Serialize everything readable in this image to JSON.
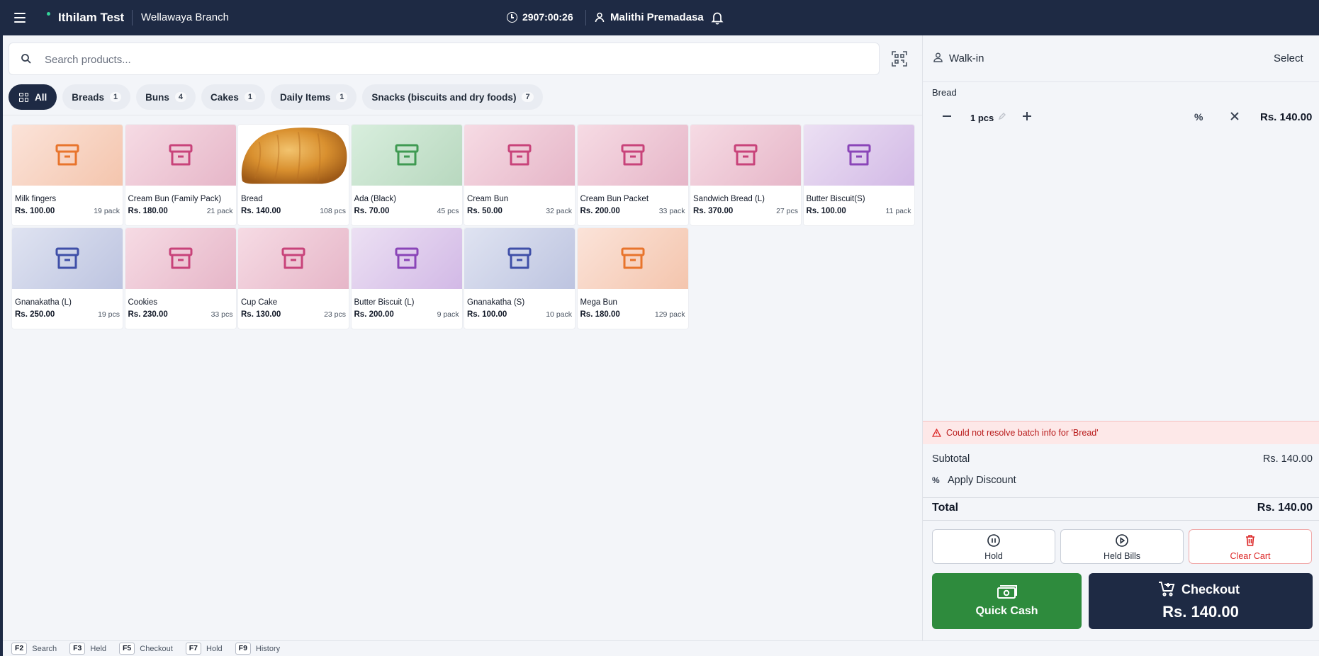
{
  "header": {
    "company": "Ithilam Test",
    "branch": "Wellawaya Branch",
    "session_time": "2907:00:26",
    "user": "Malithi Premadasa"
  },
  "search": {
    "placeholder": "Search products..."
  },
  "categories": [
    {
      "label": "All",
      "count": ""
    },
    {
      "label": "Breads",
      "count": "1"
    },
    {
      "label": "Buns",
      "count": "4"
    },
    {
      "label": "Cakes",
      "count": "1"
    },
    {
      "label": "Daily Items",
      "count": "1"
    },
    {
      "label": "Snacks (biscuits and dry foods)",
      "count": "7"
    }
  ],
  "products": [
    {
      "name": "Milk fingers",
      "price": "Rs. 100.00",
      "stock": "19 pack",
      "color": "orange"
    },
    {
      "name": "Cream Bun (Family Pack)",
      "price": "Rs. 180.00",
      "stock": "21 pack",
      "color": "pink"
    },
    {
      "name": "Bread",
      "price": "Rs. 140.00",
      "stock": "108 pcs",
      "color": "bread"
    },
    {
      "name": "Ada (Black)",
      "price": "Rs. 70.00",
      "stock": "45 pcs",
      "color": "green"
    },
    {
      "name": "Cream Bun",
      "price": "Rs. 50.00",
      "stock": "32 pack",
      "color": "pink"
    },
    {
      "name": "Cream Bun Packet",
      "price": "Rs. 200.00",
      "stock": "33 pack",
      "color": "pink"
    },
    {
      "name": "Sandwich Bread (L)",
      "price": "Rs. 370.00",
      "stock": "27 pcs",
      "color": "pink"
    },
    {
      "name": "Butter Biscuit(S)",
      "price": "Rs. 100.00",
      "stock": "11 pack",
      "color": "purple"
    },
    {
      "name": "Gnanakatha (L)",
      "price": "Rs. 250.00",
      "stock": "19 pcs",
      "color": "blue"
    },
    {
      "name": "Cookies",
      "price": "Rs. 230.00",
      "stock": "33 pcs",
      "color": "pink"
    },
    {
      "name": "Cup Cake",
      "price": "Rs. 130.00",
      "stock": "23 pcs",
      "color": "pink"
    },
    {
      "name": "Butter Biscuit (L)",
      "price": "Rs. 200.00",
      "stock": "9 pack",
      "color": "purple"
    },
    {
      "name": "Gnanakatha (S)",
      "price": "Rs. 100.00",
      "stock": "10 pack",
      "color": "blue"
    },
    {
      "name": "Mega Bun",
      "price": "Rs. 180.00",
      "stock": "129 pack",
      "color": "orange"
    }
  ],
  "icon_colors": {
    "orange": "#e8742c",
    "pink": "#c8437a",
    "green": "#3f9a52",
    "purple": "#8a45b8",
    "blue": "#3f4fa8"
  },
  "cart": {
    "customer": "Walk-in",
    "select_label": "Select",
    "line": {
      "category": "Bread",
      "qty": "1 pcs",
      "total": "Rs. 140.00"
    },
    "warning": "Could not resolve batch info for 'Bread'",
    "subtotal_label": "Subtotal",
    "subtotal": "Rs. 140.00",
    "discount_label": "Apply Discount",
    "total_label": "Total",
    "total": "Rs. 140.00",
    "hold_label": "Hold",
    "held_bills_label": "Held Bills",
    "clear_label": "Clear Cart",
    "quick_cash_label": "Quick Cash",
    "checkout_label": "Checkout",
    "checkout_amount": "Rs. 140.00"
  },
  "shortcuts": [
    {
      "key": "F2",
      "label": "Search"
    },
    {
      "key": "F3",
      "label": "Held"
    },
    {
      "key": "F5",
      "label": "Checkout"
    },
    {
      "key": "F7",
      "label": "Hold"
    },
    {
      "key": "F9",
      "label": "History"
    }
  ]
}
